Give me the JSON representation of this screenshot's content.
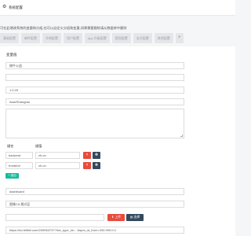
{
  "header": {
    "gear_icon": "⚙",
    "title": "系统配置"
  },
  "notice": "可在此增改系统的变量和分组,也可以自定义分组和变量,如果需要删除请从数据库中删除",
  "tabs": [
    {
      "label": "基础配置",
      "active": false
    },
    {
      "label": "邮件配置",
      "active": false
    },
    {
      "label": "字典配置",
      "active": false
    },
    {
      "label": "用户配置",
      "active": false
    },
    {
      "label": "app 升级配置",
      "active": false
    },
    {
      "label": "提现配置",
      "active": false
    },
    {
      "label": "支付配置",
      "active": false
    },
    {
      "label": "其他配置",
      "active": false
    }
  ],
  "add_tab_label": "+",
  "section_title": "变量值",
  "fields": {
    "site_name": "摊牛公益",
    "beian": "",
    "version": "1.0.25",
    "timezone": "Asia/Shanghai",
    "forbidden_ip": ""
  },
  "kv_labels": {
    "key": "键名",
    "value": "键值"
  },
  "kv_rows": [
    {
      "key": "backend",
      "value": "zh-cn"
    },
    {
      "key": "frontend",
      "value": "zh-cn"
    }
  ],
  "add_label": "+ 追加",
  "fixed_page": "dashboard",
  "category_type": "图像CA 格式区",
  "upload_label": "⬆ 上传",
  "choose_label": "▤ 选择",
  "url_value": "https://lxx.bilibili.com/239064737?live_type_id=...&spm_id_from=333.999.0.0"
}
